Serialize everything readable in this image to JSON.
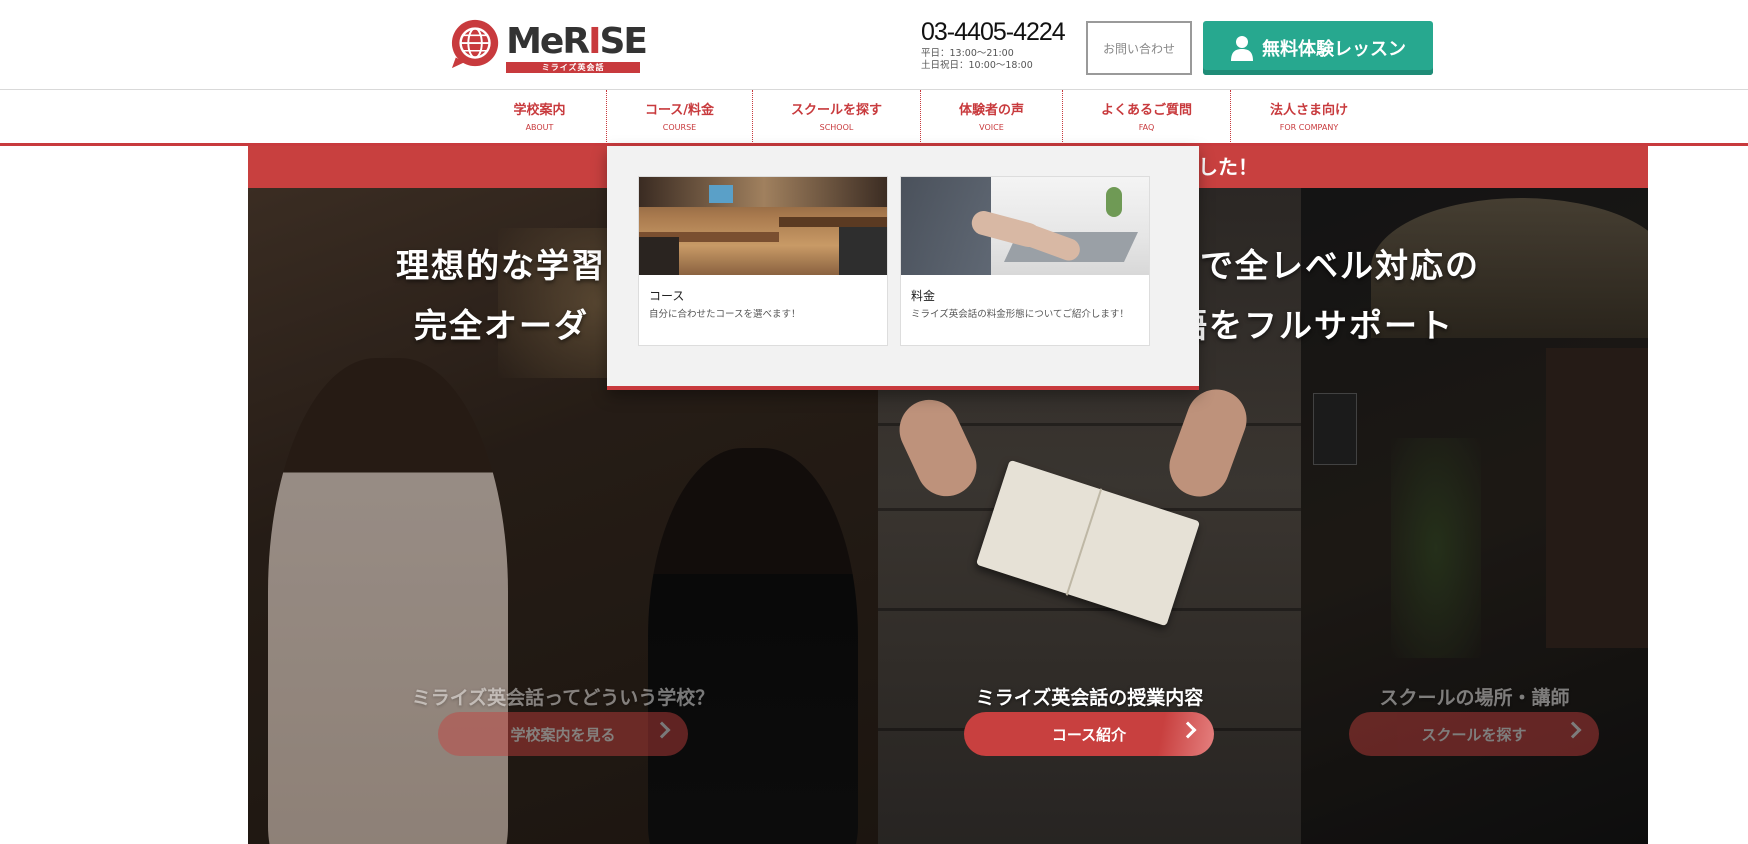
{
  "header": {
    "logo": {
      "word_start": "MeR",
      "word_accent": "I",
      "word_end": "SE",
      "tagline": "ミライズ英会話"
    },
    "phone": {
      "number": "03-4405-4224",
      "weekday": "平日：13:00〜21:00",
      "weekend": "土日祝日：10:00〜18:00"
    },
    "contact_label": "お問い合わせ",
    "trial_label": "無料体験レッスン"
  },
  "nav": [
    {
      "jp": "学校案内",
      "en": "ABOUT"
    },
    {
      "jp": "コース/料金",
      "en": "COURSE"
    },
    {
      "jp": "スクールを探す",
      "en": "SCHOOL"
    },
    {
      "jp": "体験者の声",
      "en": "VOICE"
    },
    {
      "jp": "よくあるご質問",
      "en": "FAQ"
    },
    {
      "jp": "法人さま向け",
      "en": "FOR COMPANY"
    }
  ],
  "banner": {
    "text_visible": "した！"
  },
  "hero": {
    "line1_left": "理想的な学習",
    "line1_right": "で全レベル対応の",
    "line2_left": "完全オーダ",
    "line2_right": "語をフルサポート"
  },
  "panels": [
    {
      "caption": "ミライズ英会話ってどういう学校？",
      "button": "学校案内を見る"
    },
    {
      "caption": "ミライズ英会話の授業内容",
      "button": "コース紹介"
    },
    {
      "caption": "スクールの場所・講師",
      "button": "スクールを探す"
    }
  ],
  "dropdown": {
    "cards": [
      {
        "title": "コース",
        "desc": "自分に合わせたコースを選べます！"
      },
      {
        "title": "料金",
        "desc": "ミライズ英会話の料金形態についてご紹介します！"
      }
    ]
  },
  "colors": {
    "brand_red": "#c83a3d",
    "trial_green": "#27a88f"
  }
}
